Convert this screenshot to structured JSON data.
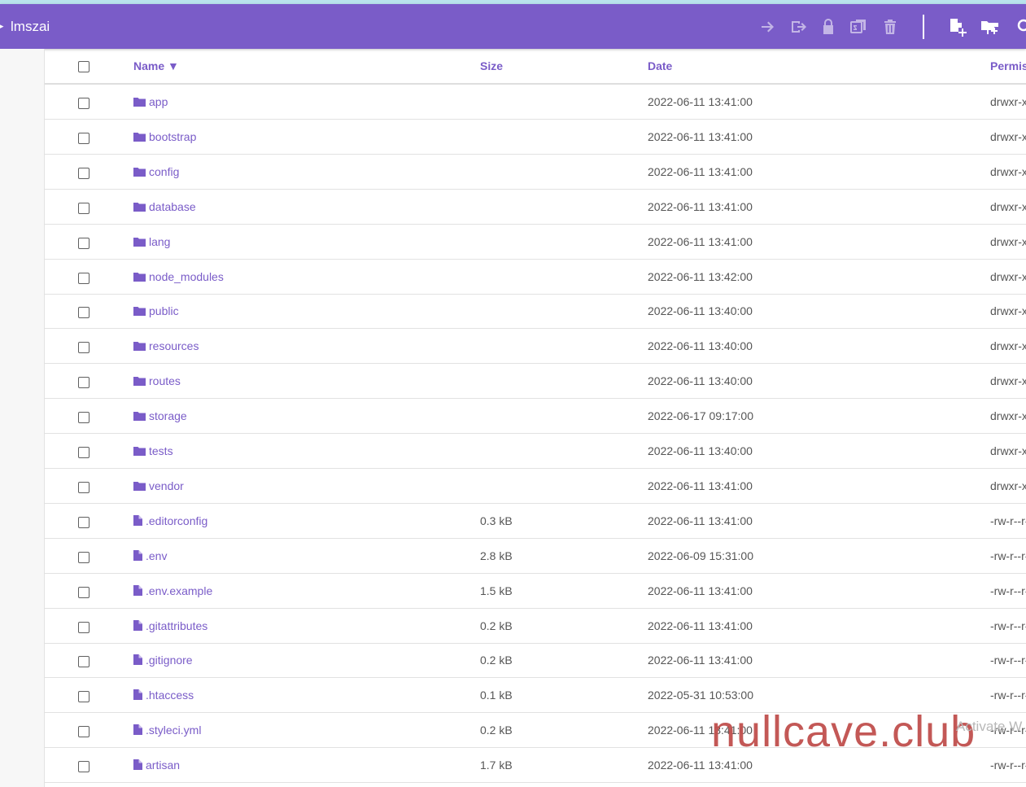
{
  "header": {
    "breadcrumb_arrow": "▸",
    "title": "lmszai",
    "tools": [
      "move-icon",
      "rename-icon",
      "lock-icon",
      "zip-icon",
      "trash-icon",
      "new-file-icon",
      "new-folder-icon",
      "search-icon"
    ]
  },
  "table": {
    "columns": {
      "name": "Name ▼",
      "size": "Size",
      "date": "Date",
      "perms": "Permis"
    },
    "rows": [
      {
        "type": "folder",
        "name": "app",
        "size": "",
        "date": "2022-06-11 13:41:00",
        "perms": "drwxr-x"
      },
      {
        "type": "folder",
        "name": "bootstrap",
        "size": "",
        "date": "2022-06-11 13:41:00",
        "perms": "drwxr-x"
      },
      {
        "type": "folder",
        "name": "config",
        "size": "",
        "date": "2022-06-11 13:41:00",
        "perms": "drwxr-x"
      },
      {
        "type": "folder",
        "name": "database",
        "size": "",
        "date": "2022-06-11 13:41:00",
        "perms": "drwxr-x"
      },
      {
        "type": "folder",
        "name": "lang",
        "size": "",
        "date": "2022-06-11 13:41:00",
        "perms": "drwxr-x"
      },
      {
        "type": "folder",
        "name": "node_modules",
        "size": "",
        "date": "2022-06-11 13:42:00",
        "perms": "drwxr-x"
      },
      {
        "type": "folder",
        "name": "public",
        "size": "",
        "date": "2022-06-11 13:40:00",
        "perms": "drwxr-x"
      },
      {
        "type": "folder",
        "name": "resources",
        "size": "",
        "date": "2022-06-11 13:40:00",
        "perms": "drwxr-x"
      },
      {
        "type": "folder",
        "name": "routes",
        "size": "",
        "date": "2022-06-11 13:40:00",
        "perms": "drwxr-x"
      },
      {
        "type": "folder",
        "name": "storage",
        "size": "",
        "date": "2022-06-17 09:17:00",
        "perms": "drwxr-x"
      },
      {
        "type": "folder",
        "name": "tests",
        "size": "",
        "date": "2022-06-11 13:40:00",
        "perms": "drwxr-x"
      },
      {
        "type": "folder",
        "name": "vendor",
        "size": "",
        "date": "2022-06-11 13:41:00",
        "perms": "drwxr-x"
      },
      {
        "type": "file",
        "name": ".editorconfig",
        "size": "0.3 kB",
        "date": "2022-06-11 13:41:00",
        "perms": "-rw-r--r-"
      },
      {
        "type": "file",
        "name": ".env",
        "size": "2.8 kB",
        "date": "2022-06-09 15:31:00",
        "perms": "-rw-r--r-"
      },
      {
        "type": "file",
        "name": ".env.example",
        "size": "1.5 kB",
        "date": "2022-06-11 13:41:00",
        "perms": "-rw-r--r-"
      },
      {
        "type": "file",
        "name": ".gitattributes",
        "size": "0.2 kB",
        "date": "2022-06-11 13:41:00",
        "perms": "-rw-r--r-"
      },
      {
        "type": "file",
        "name": ".gitignore",
        "size": "0.2 kB",
        "date": "2022-06-11 13:41:00",
        "perms": "-rw-r--r-"
      },
      {
        "type": "file",
        "name": ".htaccess",
        "size": "0.1 kB",
        "date": "2022-05-31 10:53:00",
        "perms": "-rw-r--r-"
      },
      {
        "type": "file",
        "name": ".styleci.yml",
        "size": "0.2 kB",
        "date": "2022-06-11 13:41:00",
        "perms": "-rw-r--r-"
      },
      {
        "type": "file",
        "name": "artisan",
        "size": "1.7 kB",
        "date": "2022-06-11 13:41:00",
        "perms": "-rw-r--r-"
      }
    ]
  },
  "overlay": {
    "watermark": "nullcave.club",
    "activate": "Activate W"
  },
  "colors": {
    "accent": "#7a5cc8",
    "text": "#555555",
    "watermark": "#c0504d"
  }
}
